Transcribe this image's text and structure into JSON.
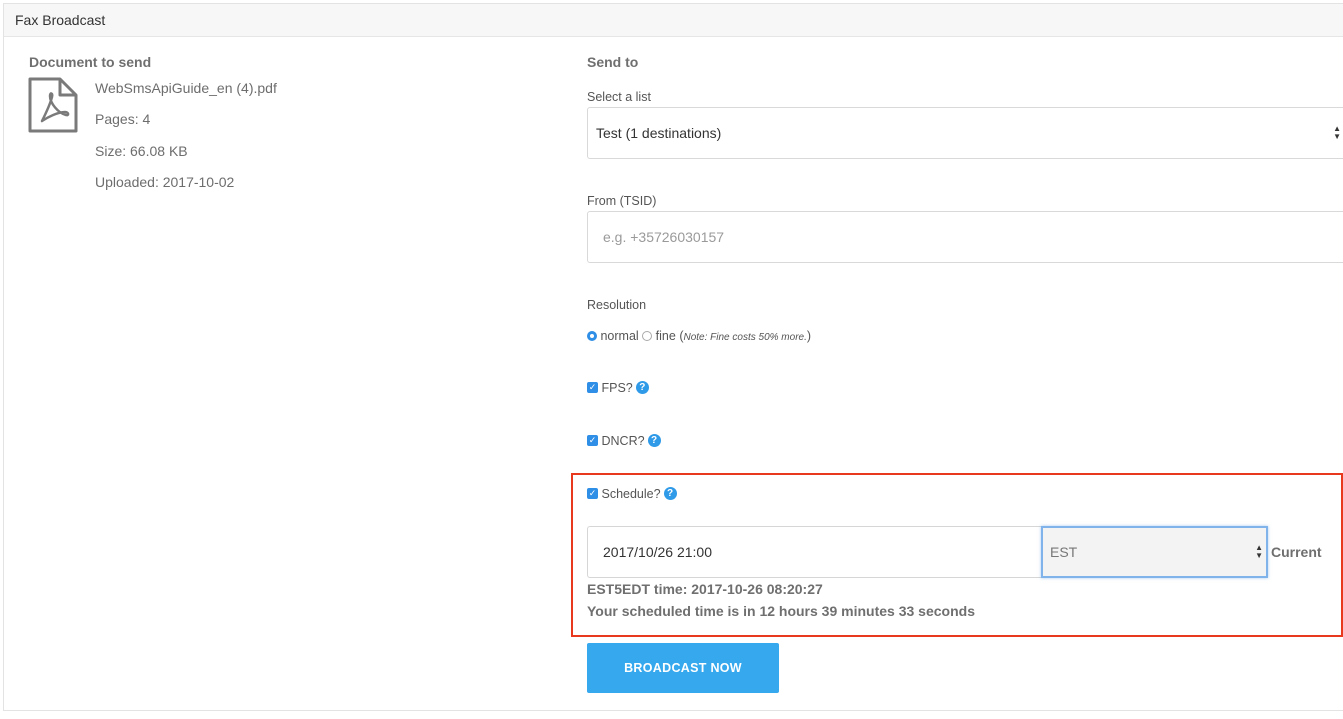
{
  "panel": {
    "title": "Fax Broadcast"
  },
  "document": {
    "section_title": "Document to send",
    "icon": "pdf-file-icon",
    "file_name": "WebSmsApiGuide_en (4).pdf",
    "pages": "Pages: 4",
    "size": "Size: 66.08 KB",
    "uploaded": "Uploaded: 2017-10-02"
  },
  "send_to": {
    "section_title": "Send to",
    "list_label": "Select a list",
    "list_value": "Test (1 destinations)",
    "from_label": "From (TSID)",
    "from_placeholder": "e.g. +35726030157",
    "from_value": "",
    "resolution_label": "Resolution",
    "resolution_normal": "normal",
    "resolution_fine": "fine",
    "resolution_note_open": "(",
    "resolution_note": "Note: Fine costs 50% more.",
    "resolution_note_close": ")",
    "resolution_selected": "normal",
    "fps_label": "FPS?",
    "fps_checked": true,
    "dncr_label": "DNCR?",
    "dncr_checked": true,
    "help_glyph": "?",
    "check_glyph": "✓"
  },
  "schedule": {
    "label": "Schedule?",
    "checked": true,
    "datetime_value": "2017/10/26 21:00",
    "timezone_value": "EST",
    "current_label": "Current",
    "tz_time": "EST5EDT time: 2017-10-26 08:20:27",
    "countdown": "Your scheduled time is in 12 hours 39 minutes 33 seconds",
    "highlight_color": "#e8391e"
  },
  "actions": {
    "broadcast_label": "BROADCAST NOW",
    "broadcast_color": "#35a8ee"
  },
  "select_arrows": "▲▼"
}
